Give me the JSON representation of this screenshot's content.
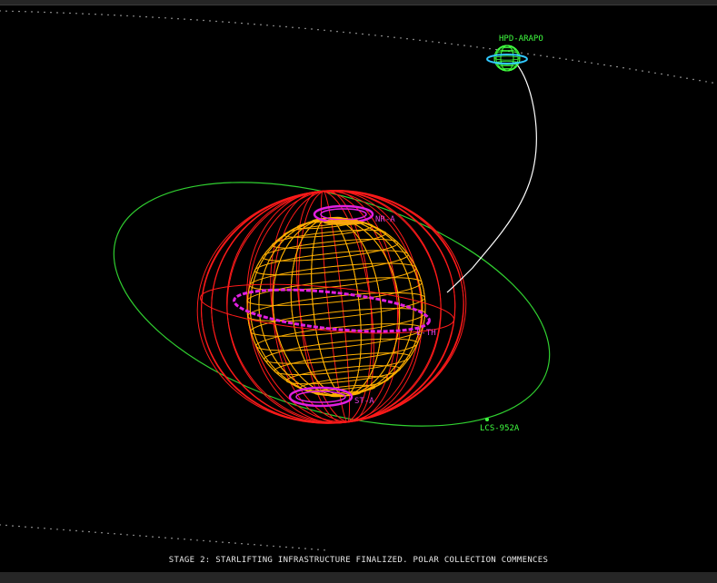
{
  "scene": {
    "caption": "STAGE 2: STARLIFTING INFRASTRUCTURE FINALIZED. POLAR COLLECTION COMMENCES",
    "labels": {
      "station": "HPD-ARAPO",
      "collector": "LCS-952A",
      "north_ring": "NR-A",
      "equator_ring": "E-TH",
      "south_ring": "ST-A"
    }
  },
  "colors": {
    "background": "#000000",
    "star_wire": "#ffb000",
    "orbit_red": "#ff1a1a",
    "ring_magenta": "#e020e0",
    "label_magenta": "#e040e0",
    "orbit_green": "#30d030",
    "label_green": "#40ff40",
    "planet_green": "#40ff40",
    "planet_ring": "#30c8ff",
    "tether": "#ffffff",
    "caption": "#e8e8e8"
  }
}
